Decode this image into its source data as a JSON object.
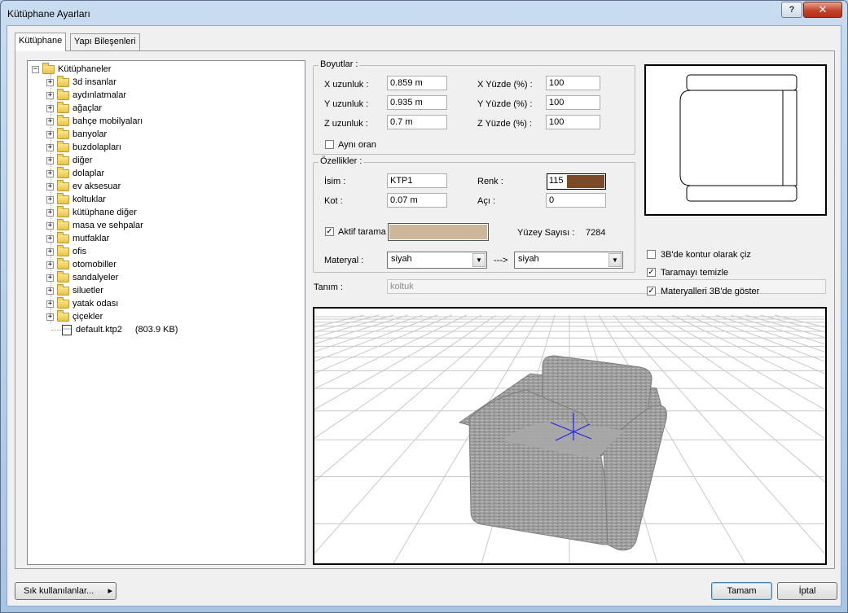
{
  "window": {
    "title": "Kütüphane Ayarları",
    "help_label": "?",
    "close_label": "✕"
  },
  "tabs": [
    {
      "label": "Kütüphane",
      "active": true
    },
    {
      "label": "Yapı Bileşenleri",
      "active": false
    }
  ],
  "tree": {
    "root": "Kütüphaneler",
    "folders": [
      "3d insanlar",
      "aydınlatmalar",
      "ağaçlar",
      "bahçe mobilyaları",
      "banyolar",
      "buzdolapları",
      "diğer",
      "dolaplar",
      "ev aksesuar",
      "koltuklar",
      "kütüphane diğer",
      "masa ve sehpalar",
      "mutfaklar",
      "ofis",
      "otomobiller",
      "sandalyeler",
      "siluetler",
      "yatak odası",
      "çiçekler"
    ],
    "file": {
      "name": "default.ktp2",
      "size": "(803.9 KB)"
    },
    "expand_symbol": "+",
    "collapse_symbol": "−"
  },
  "boyutlar": {
    "label": "Boyutlar :",
    "x_label": "X uzunluk :",
    "x_value": "0.859 m",
    "y_label": "Y uzunluk :",
    "y_value": "0.935 m",
    "z_label": "Z uzunluk :",
    "z_value": "0.7 m",
    "xp_label": "X Yüzde (%) :",
    "xp_value": "100",
    "yp_label": "Y Yüzde (%) :",
    "yp_value": "100",
    "zp_label": "Z Yüzde (%) :",
    "zp_value": "100",
    "same_ratio_label": "Aynı oran",
    "same_ratio_checked": false
  },
  "ozellikler": {
    "label": "Özellikler :",
    "isim_label": "İsim :",
    "isim_value": "KTP1",
    "kot_label": "Kot :",
    "kot_value": "0.07 m",
    "renk_label": "Renk :",
    "renk_value": "115",
    "renk_color": "#7b4a28",
    "aci_label": "Açı :",
    "aci_value": "0",
    "aktif_tarama_label": "Aktif tarama",
    "aktif_tarama_checked": true,
    "tarama_color": "#cdb79a",
    "yuzey_label": "Yüzey Sayısı :",
    "yuzey_value": "7284",
    "materyal_label": "Materyal :",
    "materyal_from": "siyah",
    "arrow_label": "--->",
    "materyal_to": "siyah"
  },
  "tanim": {
    "label": "Tanım :",
    "value": "koltuk"
  },
  "options": {
    "kontur_label": "3B'de kontur olarak çiz",
    "kontur_checked": false,
    "temizle_label": "Taramayı temizle",
    "temizle_checked": true,
    "materyal_goster_label": "Materyalleri 3B'de göster",
    "materyal_goster_checked": true
  },
  "check_mark": "✓",
  "footer": {
    "favorites_label": "Sık kullanılanlar...",
    "favorites_arrow": "▸",
    "ok_label": "Tamam",
    "cancel_label": "İptal"
  },
  "icons": {
    "combo_arrow": "▼"
  }
}
